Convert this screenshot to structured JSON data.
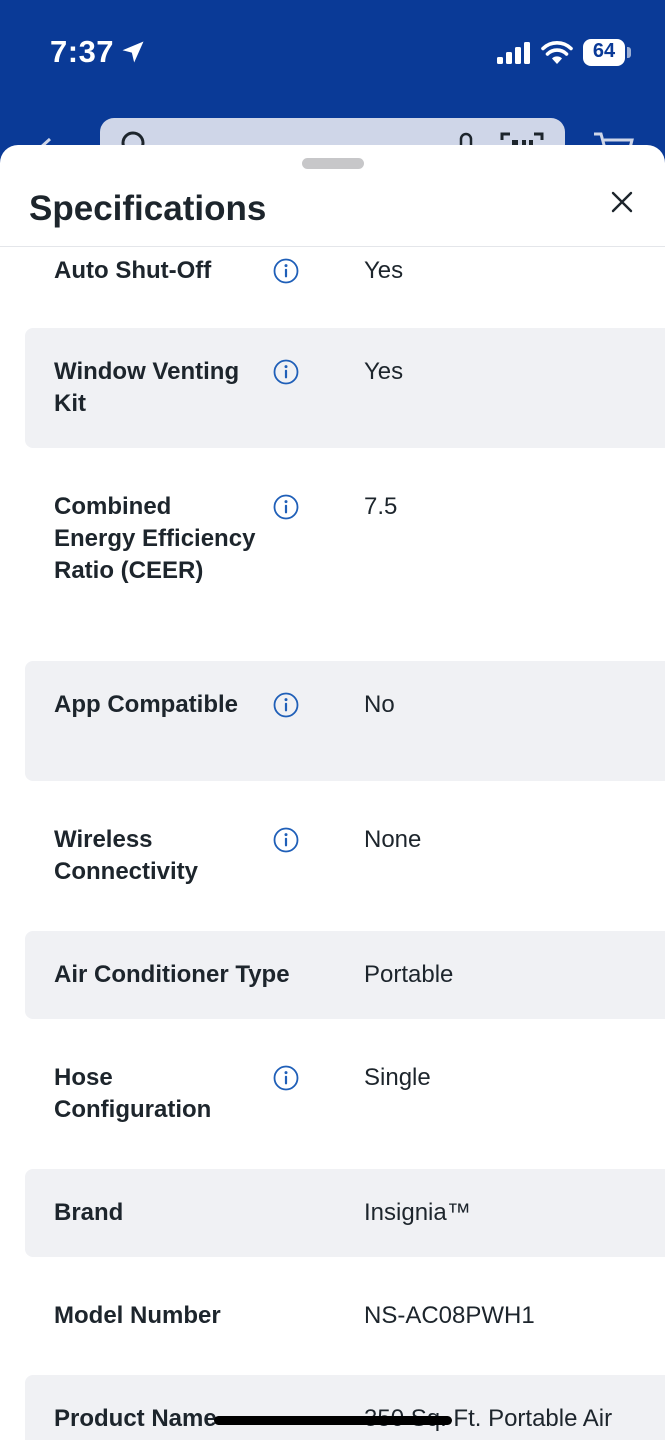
{
  "status_bar": {
    "time": "7:37",
    "battery": "64"
  },
  "sheet": {
    "title": "Specifications"
  },
  "colors": {
    "brand_blue": "#0a3a97",
    "info_icon": "#1f5fb8",
    "row_shade": "#f0f1f4",
    "text": "#1d252c"
  },
  "specs": [
    {
      "label": "Auto Shut-Off",
      "value": "Yes",
      "info": true
    },
    {
      "label": "Window Venting Kit",
      "value": "Yes",
      "info": true
    },
    {
      "label": "Combined Energy Efficiency Ratio (CEER)",
      "value": "7.5",
      "info": true
    },
    {
      "label": "App Compatible",
      "value": "No",
      "info": true
    },
    {
      "label": "Wireless Connectivity",
      "value": "None",
      "info": true
    },
    {
      "label": "Air Conditioner Type",
      "value": "Portable",
      "info": false
    },
    {
      "label": "Hose Configuration",
      "value": "Single",
      "info": true
    },
    {
      "label": "Brand",
      "value": "Insignia™",
      "info": false
    },
    {
      "label": "Model Number",
      "value": "NS-AC08PWH1",
      "info": false
    },
    {
      "label": "Product Name",
      "value": "350 Sq. Ft. Portable Air",
      "info": false
    }
  ]
}
